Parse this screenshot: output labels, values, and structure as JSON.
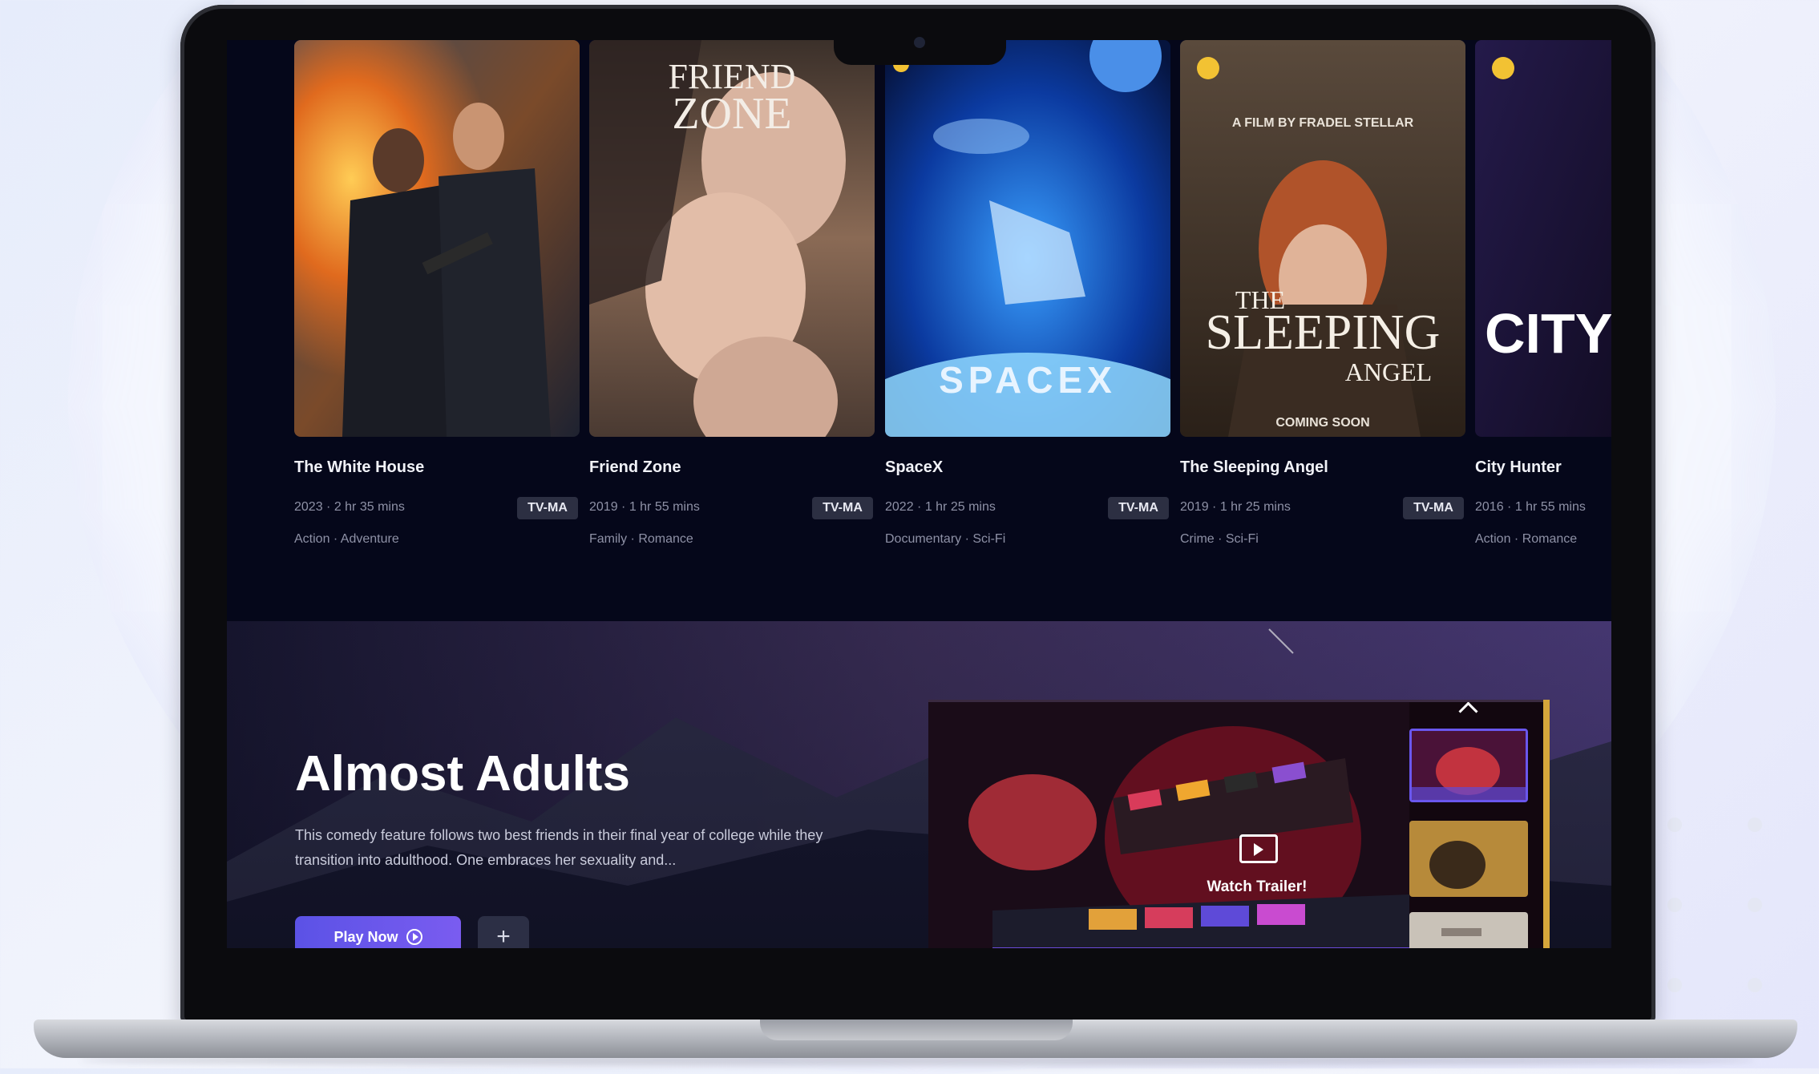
{
  "movies": [
    {
      "title": "The White House",
      "meta": "2023  ·  2 hr 35 mins",
      "rating": "TV-MA",
      "genres": "Action  ·  Adventure"
    },
    {
      "title": "Friend Zone",
      "meta": "2019  ·  1 hr 55 mins",
      "rating": "TV-MA",
      "genres": "Family  ·  Romance",
      "poster_text": "FRIEND ZONE"
    },
    {
      "title": "SpaceX",
      "meta": "2022  ·  1 hr 25 mins",
      "rating": "TV-MA",
      "genres": "Documentary  ·  Sci-Fi",
      "poster_text": "SPACEX"
    },
    {
      "title": "The Sleeping Angel",
      "meta": "2019  ·  1 hr 25 mins",
      "rating": "TV-MA",
      "genres": "Crime  ·  Sci-Fi",
      "poster_text_small": "A FILM BY FRADEL STELLAR",
      "poster_text_the": "THE",
      "poster_text_main": "SLEEPING",
      "poster_text_sub": "ANGEL",
      "poster_text_coming": "COMING SOON"
    },
    {
      "title": "City Hunter",
      "meta": "2016  ·  1 hr 55 mins",
      "rating": "",
      "genres": "Action  ·  Romance",
      "poster_text": "CITY H"
    }
  ],
  "hero": {
    "title": "Almost Adults",
    "description": "This comedy feature follows two best friends in their final year of college while they transition into adulthood. One embraces her sexuality and...",
    "play_label": "Play Now",
    "add_label": "+",
    "trailer_label": "Watch Trailer!"
  },
  "icons": [
    "play-circle-icon",
    "plus-icon",
    "video-play-icon",
    "chevron-up-icon",
    "camera-icon"
  ],
  "colors": {
    "screen_bg": "#05071a",
    "accent": "#6a57ee",
    "badge_bg": "#2c2f42",
    "gold": "#d6a63b"
  }
}
